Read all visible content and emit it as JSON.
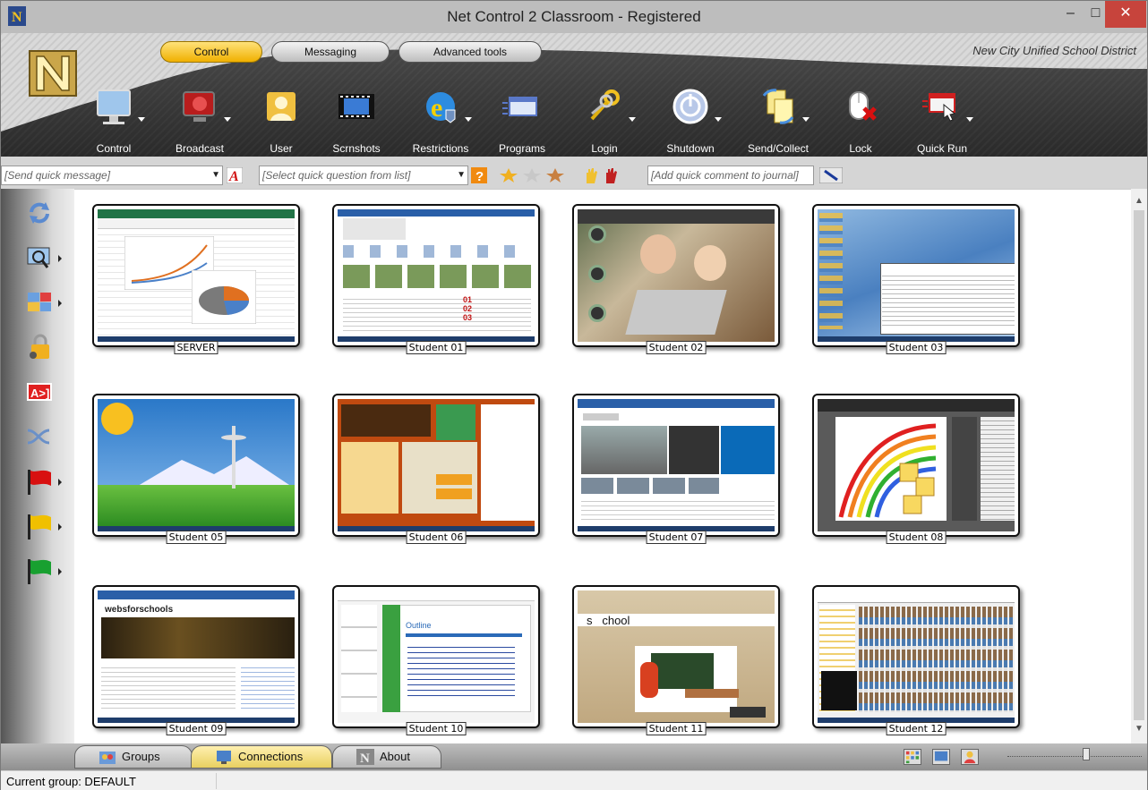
{
  "window": {
    "title": "Net Control 2 Classroom - Registered",
    "minimize": "–",
    "maximize": "□",
    "close": "✕"
  },
  "ribbon": {
    "tabs": [
      {
        "label": "Control",
        "active": true
      },
      {
        "label": "Messaging",
        "active": false
      },
      {
        "label": "Advanced tools",
        "active": false
      }
    ],
    "district": "New City Unified School District",
    "tools": [
      {
        "label": "Control",
        "icon": "monitor-icon",
        "dropdown": true
      },
      {
        "label": "Broadcast",
        "icon": "broadcast-icon",
        "dropdown": true
      },
      {
        "label": "User",
        "icon": "user-icon",
        "dropdown": false
      },
      {
        "label": "Scrnshots",
        "icon": "film-icon",
        "dropdown": false
      },
      {
        "label": "Restrictions",
        "icon": "internet-explorer-icon",
        "dropdown": true
      },
      {
        "label": "Programs",
        "icon": "programs-icon",
        "dropdown": false
      },
      {
        "label": "Login",
        "icon": "keys-icon",
        "dropdown": true
      },
      {
        "label": "Shutdown",
        "icon": "power-icon",
        "dropdown": true
      },
      {
        "label": "Send/Collect",
        "icon": "send-collect-icon",
        "dropdown": true
      },
      {
        "label": "Lock",
        "icon": "mouse-lock-icon",
        "dropdown": false
      },
      {
        "label": "Quick Run",
        "icon": "quick-run-icon",
        "dropdown": true
      }
    ],
    "quick_message_placeholder": "[Send quick message]",
    "quick_question_placeholder": "[Select quick question from list]",
    "journal_placeholder": "[Add quick comment to journal]"
  },
  "sidebar": {
    "icons": [
      "refresh-icon",
      "search-screen-icon",
      "layout-icon",
      "lock-user-icon",
      "text-icon",
      "shuffle-icon",
      "red-flag-icon",
      "yellow-flag-icon",
      "green-flag-icon"
    ]
  },
  "students": [
    {
      "name": "SERVER",
      "theme": "excel"
    },
    {
      "name": "Student 01",
      "theme": "news"
    },
    {
      "name": "Student 02",
      "theme": "kids"
    },
    {
      "name": "Student 03",
      "theme": "desktop-ice"
    },
    {
      "name": "Student 05",
      "theme": "seattle"
    },
    {
      "name": "Student 06",
      "theme": "orange-site"
    },
    {
      "name": "Student 07",
      "theme": "msn"
    },
    {
      "name": "Student 08",
      "theme": "paint"
    },
    {
      "name": "Student 09",
      "theme": "websforschools"
    },
    {
      "name": "Student 10",
      "theme": "powerpoint"
    },
    {
      "name": "Student 11",
      "theme": "school-game"
    },
    {
      "name": "Student 12",
      "theme": "photos"
    }
  ],
  "bottom_tabs": [
    {
      "label": "Groups",
      "active": false
    },
    {
      "label": "Connections",
      "active": true
    },
    {
      "label": "About",
      "active": false
    }
  ],
  "status": {
    "text": "Current group: DEFAULT"
  },
  "colors": {
    "accent": "#f0b000",
    "ribbon_dark": "#3a3a3a",
    "close": "#c7443c"
  }
}
